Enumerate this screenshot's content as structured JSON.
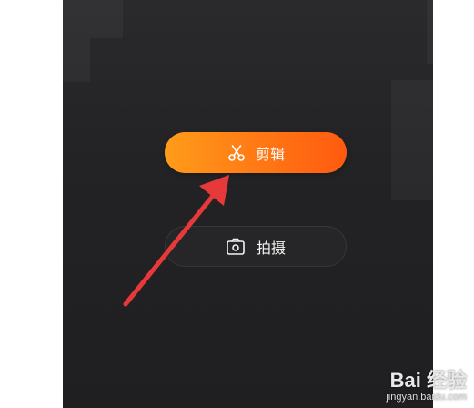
{
  "buttons": {
    "edit_label": "剪辑",
    "shoot_label": "拍摄",
    "edit_icon": "scissors-icon",
    "shoot_icon": "camera-icon"
  },
  "colors": {
    "background": "#232325",
    "edit_gradient_start": "#ff9c1a",
    "edit_gradient_end": "#ff5a10",
    "arrow": "#e8393a"
  },
  "watermark": {
    "logo": "Bai 经验",
    "url": "jingyan.baidu.com"
  }
}
